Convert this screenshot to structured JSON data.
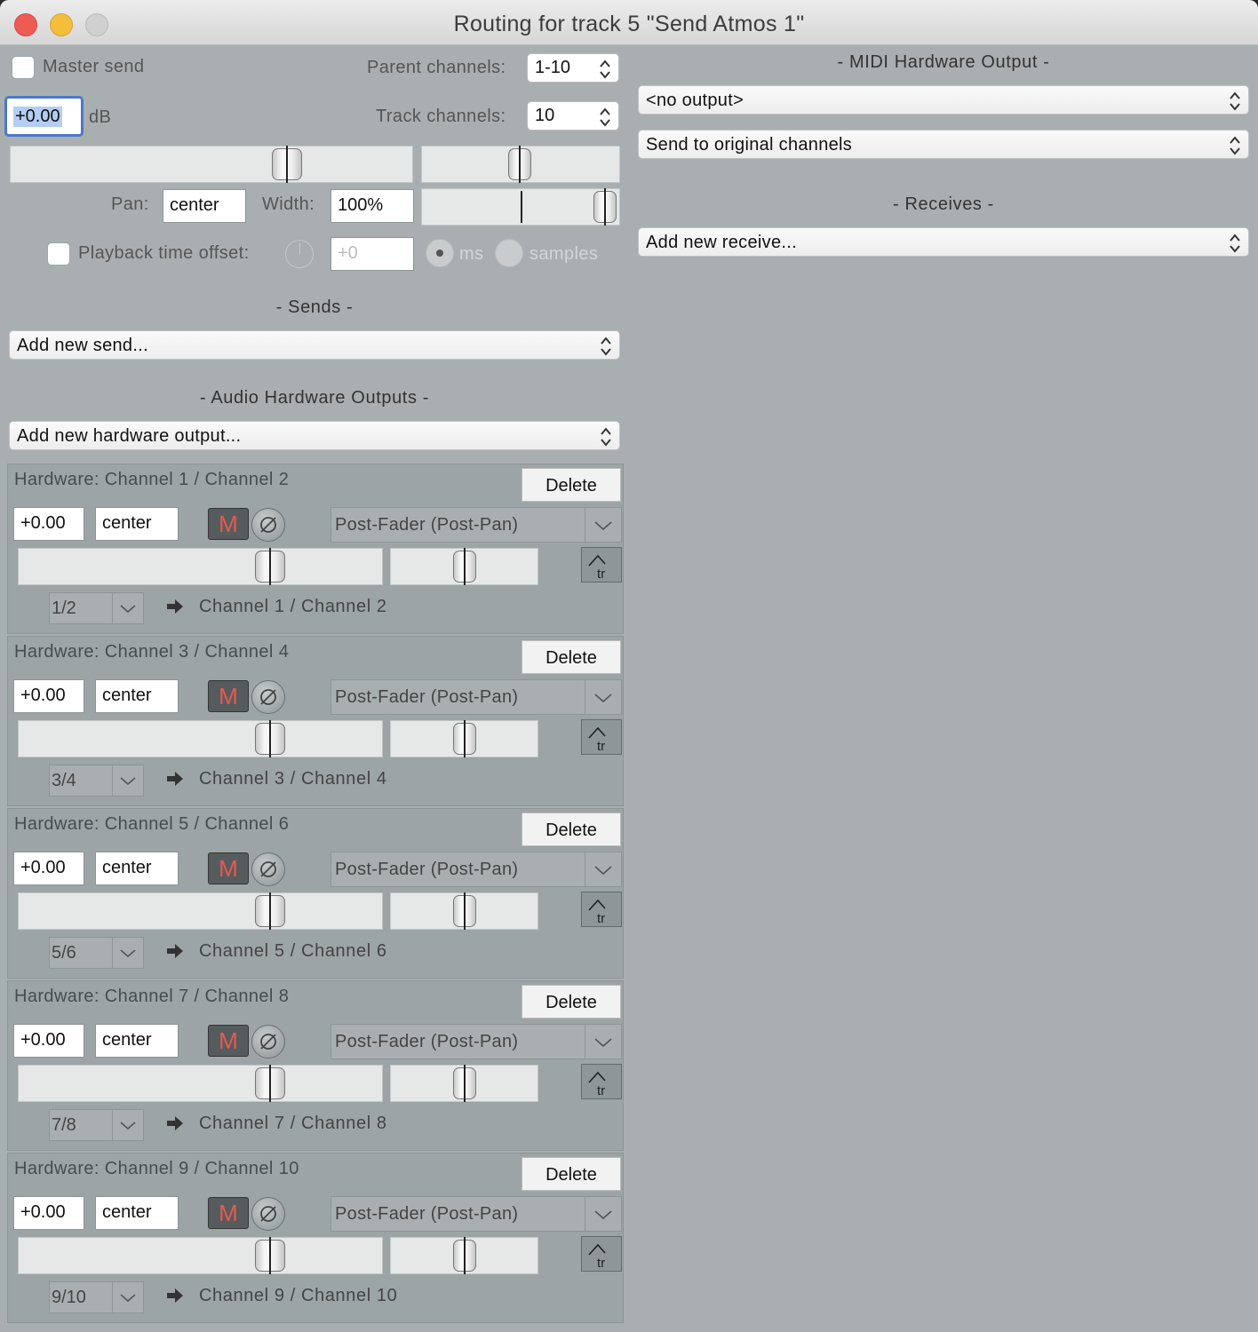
{
  "window": {
    "title": "Routing for track 5 \"Send Atmos 1\""
  },
  "master": {
    "master_send_label": "Master send",
    "parent_channels_label": "Parent channels:",
    "parent_channels_value": "1-10",
    "volume_value": "+0.00",
    "db_label": "dB",
    "track_channels_label": "Track channels:",
    "track_channels_value": "10",
    "pan_label": "Pan:",
    "pan_value": "center",
    "width_label": "Width:",
    "width_value": "100%",
    "playback_offset_label": "Playback time offset:",
    "playback_offset_value": "+0",
    "ms_label": "ms",
    "samples_label": "samples"
  },
  "sends": {
    "header": "-  Sends  -",
    "add_label": "Add new send..."
  },
  "audio_hw": {
    "header": "-  Audio Hardware Outputs  -",
    "add_label": "Add new hardware output..."
  },
  "midi_hw": {
    "header": "-  MIDI Hardware Output  -",
    "output_value": "<no output>",
    "channels_value": "Send to original channels"
  },
  "receives": {
    "header": "-  Receives  -",
    "add_label": "Add new receive..."
  },
  "hw_outputs": [
    {
      "name": "Hardware: Channel 1 / Channel 2",
      "delete": "Delete",
      "volume": "+0.00",
      "pan": "center",
      "mute": "M",
      "mode": "Post-Fader (Post-Pan)",
      "channels": "1/2",
      "destination": "Channel 1  /  Channel 2"
    },
    {
      "name": "Hardware: Channel 3 / Channel 4",
      "delete": "Delete",
      "volume": "+0.00",
      "pan": "center",
      "mute": "M",
      "mode": "Post-Fader (Post-Pan)",
      "channels": "3/4",
      "destination": "Channel 3  /  Channel 4"
    },
    {
      "name": "Hardware: Channel 5 / Channel 6",
      "delete": "Delete",
      "volume": "+0.00",
      "pan": "center",
      "mute": "M",
      "mode": "Post-Fader (Post-Pan)",
      "channels": "5/6",
      "destination": "Channel 5  /  Channel 6"
    },
    {
      "name": "Hardware: Channel 7 / Channel 8",
      "delete": "Delete",
      "volume": "+0.00",
      "pan": "center",
      "mute": "M",
      "mode": "Post-Fader (Post-Pan)",
      "channels": "7/8",
      "destination": "Channel 7  /  Channel 8"
    },
    {
      "name": "Hardware: Channel 9 / Channel 10",
      "delete": "Delete",
      "volume": "+0.00",
      "pan": "center",
      "mute": "M",
      "mode": "Post-Fader (Post-Pan)",
      "channels": "9/10",
      "destination": "Channel 9  /  Channel 10"
    }
  ]
}
